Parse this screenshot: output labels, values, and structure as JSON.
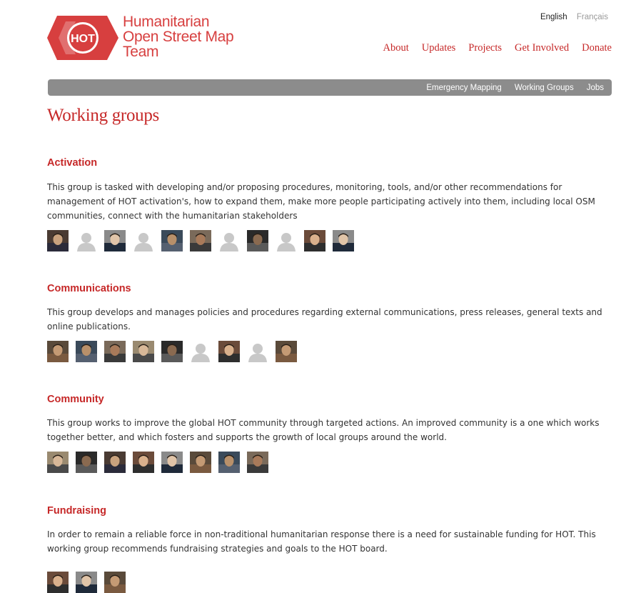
{
  "brand": {
    "logo_text": "HOT",
    "lines": [
      "Humanitarian",
      "Open Street Map",
      "Team"
    ],
    "color": "#d73f3f"
  },
  "language": {
    "active": "English",
    "other": "Français"
  },
  "main_nav": [
    "About",
    "Updates",
    "Projects",
    "Get Involved",
    "Donate"
  ],
  "sub_nav": [
    "Emergency Mapping",
    "Working Groups",
    "Jobs"
  ],
  "page_title": "Working groups",
  "groups": [
    {
      "name": "Activation",
      "description": "This group is tasked with developing and/or proposing procedures, monitoring, tools, and/or other recommendations for management of HOT activation's, how to expand them, make more people participating actively into them, including local OSM communities, connect with the humanitarian stakeholders",
      "members": [
        "photo",
        "placeholder",
        "photo",
        "placeholder",
        "photo",
        "photo",
        "placeholder",
        "photo",
        "placeholder",
        "photo",
        "photo"
      ]
    },
    {
      "name": "Communications",
      "description": "This group develops and manages policies and procedures regarding external communications, press releases, general texts and online publications.",
      "members": [
        "photo",
        "photo",
        "photo",
        "photo",
        "photo",
        "placeholder",
        "photo",
        "placeholder",
        "photo"
      ]
    },
    {
      "name": "Community",
      "description": "This group works to improve the global HOT community through targeted actions. An improved community is a one which works together better, and which fosters and supports the growth of local groups around the world.",
      "members": [
        "photo",
        "photo",
        "photo",
        "photo",
        "photo",
        "photo",
        "photo",
        "photo"
      ]
    },
    {
      "name": "Fundraising",
      "description": "In order to remain a reliable force in non-traditional humanitarian response there is a need for sustainable funding for HOT. This working group recommends fundraising strategies and goals to the HOT board.",
      "members": [
        "photo",
        "photo",
        "photo"
      ]
    }
  ],
  "colors": {
    "accent": "#c62828",
    "subnav_bg": "#8c8c8c",
    "placeholder_avatar": "#c8c8c8"
  }
}
